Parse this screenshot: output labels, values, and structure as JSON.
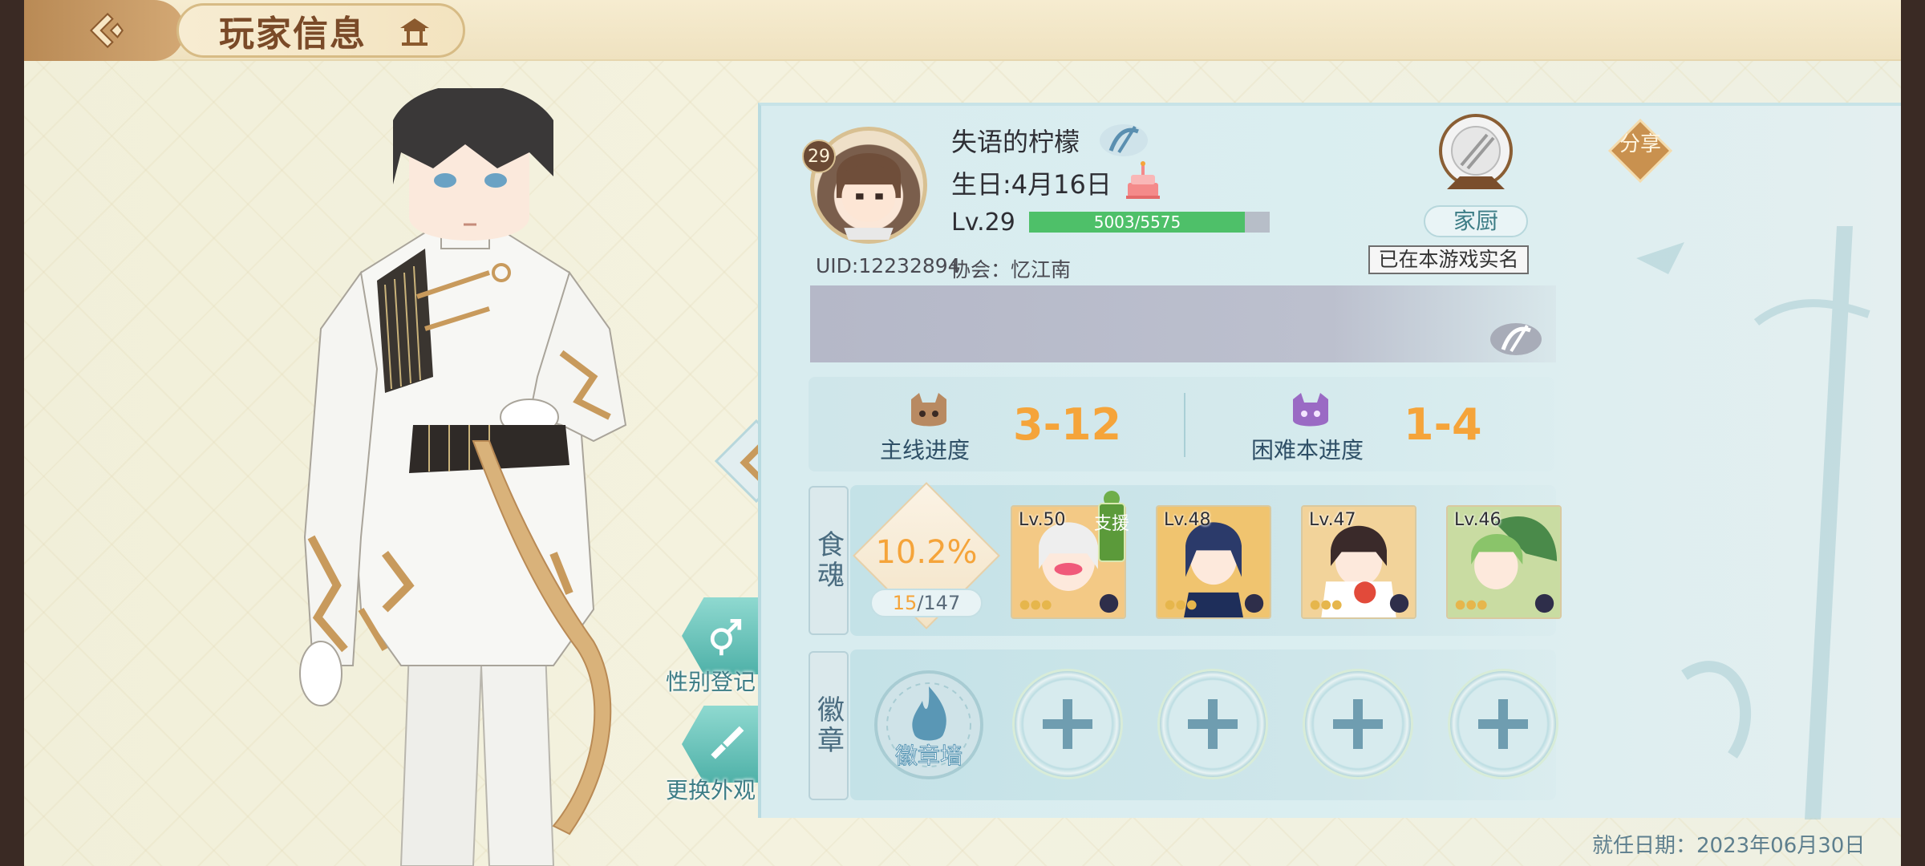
{
  "header": {
    "title": "玩家信息"
  },
  "player": {
    "avatar_level": "29",
    "name": "失语的柠檬",
    "birthday": "生日:4月16日",
    "level_label": "Lv.29",
    "exp": {
      "text": "5003/5575",
      "current": 5003,
      "max": 5575
    },
    "uid": "UID:12232894",
    "guild": "协会：忆江南",
    "chef_label": "家厨",
    "realname_status": "已在本游戏实名",
    "share_label": "分享"
  },
  "progress": {
    "main": {
      "label": "主线进度",
      "value": "3-12"
    },
    "hard": {
      "label": "困难本进度",
      "value": "1-4"
    }
  },
  "food_souls": {
    "tag": "食魂",
    "percent": "10.2%",
    "count_current": "15",
    "count_total": "/147",
    "support_label": "支援",
    "cards": [
      {
        "level": "Lv.50",
        "color": "#f3c985"
      },
      {
        "level": "Lv.48",
        "color": "#f0c46f"
      },
      {
        "level": "Lv.47",
        "color": "#f2d39a"
      },
      {
        "level": "Lv.46",
        "color": "#c9dca2"
      }
    ]
  },
  "badges": {
    "tag": "徽章",
    "wall_label": "徽章墙",
    "slots": 4
  },
  "side_buttons": {
    "gender": "性别登记",
    "appearance": "更换外观"
  },
  "footer": {
    "appointment_date": "就任日期：2023年06月30日"
  },
  "colors": {
    "accent_orange": "#f5a43a",
    "exp_green": "#4ec069",
    "teal": "#4fb1a8"
  }
}
